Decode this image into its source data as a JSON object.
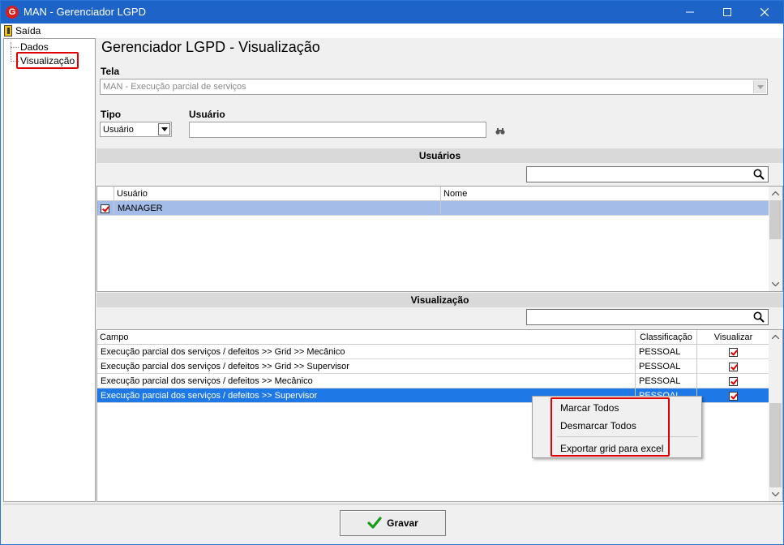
{
  "window": {
    "title": "MAN - Gerenciador LGPD",
    "app_icon_letter": "G"
  },
  "menu": {
    "exit_label": "Saída"
  },
  "sidebar": {
    "items": [
      {
        "label": "Dados"
      },
      {
        "label": "Visualização"
      }
    ]
  },
  "main": {
    "title": "Gerenciador LGPD - Visualização",
    "tela_label": "Tela",
    "tela_value": "MAN - Execução parcial de serviços",
    "tipo_label": "Tipo",
    "tipo_value": "Usuário",
    "usuario_label": "Usuário",
    "usuario_value": ""
  },
  "users_section": {
    "title": "Usuários",
    "columns": [
      "Usuário",
      "Nome"
    ],
    "rows": [
      {
        "usuario": "MANAGER",
        "nome": "",
        "checked": true
      }
    ]
  },
  "view_section": {
    "title": "Visualização",
    "columns": [
      "Campo",
      "Classificação",
      "Visualizar"
    ],
    "rows": [
      {
        "campo": "Execução parcial dos serviços / defeitos >> Grid >> Mecânico",
        "classificacao": "PESSOAL",
        "visualizar": true
      },
      {
        "campo": "Execução parcial dos serviços / defeitos >> Grid >> Supervisor",
        "classificacao": "PESSOAL",
        "visualizar": true
      },
      {
        "campo": "Execução parcial dos serviços / defeitos >> Mecânico",
        "classificacao": "PESSOAL",
        "visualizar": true
      },
      {
        "campo": "Execução parcial dos serviços / defeitos >> Supervisor",
        "classificacao": "PESSOAL",
        "visualizar": true
      }
    ]
  },
  "context_menu": {
    "items": [
      "Marcar Todos",
      "Desmarcar Todos",
      "Exportar grid para excel"
    ]
  },
  "footer": {
    "save_label": "Gravar"
  },
  "colors": {
    "titlebar": "#1e64c8",
    "selected_row": "#1e78e6",
    "user_selected_row": "#a3bde8",
    "highlight_box": "#e00000",
    "section_bar": "#d9d9d9"
  }
}
